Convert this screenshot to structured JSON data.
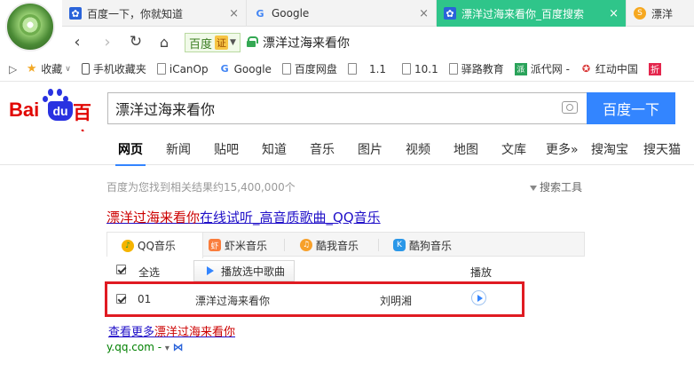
{
  "browser": {
    "tabs": [
      {
        "label": "百度一下，你就知道",
        "icon": "baidu-paw-icon"
      },
      {
        "label": "Google",
        "icon": "google-g-icon"
      },
      {
        "label": "漂洋过海来看你_百度搜索",
        "icon": "baidu-paw-icon",
        "active": true
      },
      {
        "label": "漂洋",
        "icon": "sogou-icon"
      }
    ],
    "engine_label": "百度",
    "engine_badge": "证",
    "address": "漂洋过海来看你",
    "bookmarks": [
      {
        "label": "收藏",
        "icon": "star-icon"
      },
      {
        "label": "手机收藏夹",
        "icon": "mobile-icon"
      },
      {
        "label": "iCanOp",
        "icon": "page-icon"
      },
      {
        "label": "Google",
        "icon": "google-g-icon"
      },
      {
        "label": "百度网盘",
        "icon": "page-icon"
      },
      {
        "label": "1.1",
        "icon": "page-icon"
      },
      {
        "label": "10.1",
        "icon": "page-icon"
      },
      {
        "label": "驿路教育",
        "icon": "page-icon"
      },
      {
        "label": "派代网 -",
        "icon": "paidai-icon"
      },
      {
        "label": "红动中国",
        "icon": "redocn-icon"
      },
      {
        "label": "折",
        "icon": "zhe-icon"
      }
    ]
  },
  "baidu": {
    "logo_bai": "Bai",
    "logo_du": "du",
    "logo_cn": "百度",
    "query": "漂洋过海来看你",
    "search_button": "百度一下",
    "nav_tabs": [
      "网页",
      "新闻",
      "贴吧",
      "知道",
      "音乐",
      "图片",
      "视频",
      "地图",
      "文库",
      "更多»",
      "搜淘宝",
      "搜天猫"
    ],
    "result_count": "百度为您找到相关结果约15,400,000个",
    "search_tools": "搜索工具",
    "result": {
      "title_highlight": "漂洋过海来看你",
      "title_rest": "在线试听_高音质歌曲_QQ音乐",
      "source_tabs": [
        "QQ音乐",
        "虾米音乐",
        "酷我音乐",
        "酷狗音乐"
      ],
      "select_all": "全选",
      "play_selected": "播放选中歌曲",
      "play_header": "播放",
      "song": {
        "index": "01",
        "name": "漂洋过海来看你",
        "artist": "刘明湘"
      },
      "more_prefix": "查看更多",
      "more_highlight": "漂洋过海来看你",
      "site": "y.qq.com",
      "site_suffix": " - "
    }
  }
}
